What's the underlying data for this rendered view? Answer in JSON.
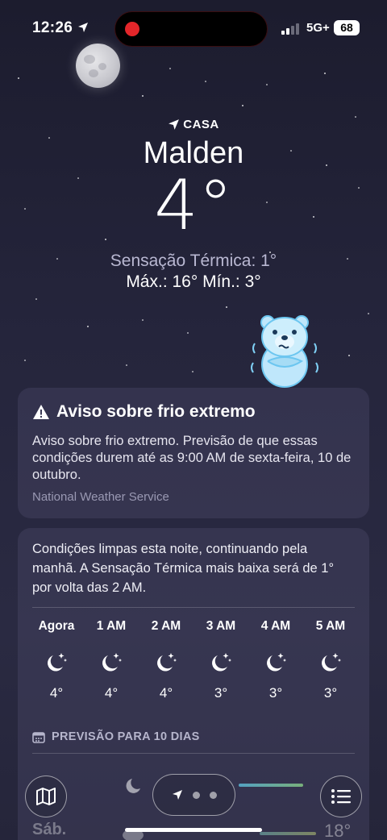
{
  "status_bar": {
    "time": "12:26",
    "network": "5G+",
    "battery": "68"
  },
  "header": {
    "location_label": "CASA",
    "city": "Malden",
    "temperature": "4°",
    "feels_like": "Sensação Térmica: 1°",
    "high_low": "Máx.: 16°  Mín.: 3°"
  },
  "alert": {
    "title": "Aviso sobre frio extremo",
    "body": "Aviso sobre frio extremo. Previsão de que essas condições durem até as 9:00 AM de sexta-feira, 10 de outubro.",
    "source": "National Weather Service"
  },
  "forecast": {
    "summary": "Condições limpas esta noite, continuando pela manhã. A Sensação Térmica mais baixa será de 1° por volta das 2 AM.",
    "hours": [
      {
        "label": "Agora",
        "icon": "moon-stars-icon",
        "temp": "4°"
      },
      {
        "label": "1 AM",
        "icon": "moon-stars-icon",
        "temp": "4°"
      },
      {
        "label": "2 AM",
        "icon": "moon-stars-icon",
        "temp": "4°"
      },
      {
        "label": "3 AM",
        "icon": "moon-stars-icon",
        "temp": "3°"
      },
      {
        "label": "4 AM",
        "icon": "moon-stars-icon",
        "temp": "3°"
      },
      {
        "label": "5 AM",
        "icon": "moon-stars-icon",
        "temp": "3°"
      }
    ],
    "ten_day_title": "PREVISÃO PARA 10 DIAS",
    "partial_row": {
      "day": "Sáb.",
      "high": "18°"
    }
  },
  "toolbar": {
    "map_icon": "map-icon",
    "list_icon": "list-icon",
    "location_icon": "location-arrow-icon"
  },
  "colors": {
    "accent_alert": "#ffffff",
    "secondary_text": "#b9b8d2",
    "recording_dot": "#e3262a"
  }
}
